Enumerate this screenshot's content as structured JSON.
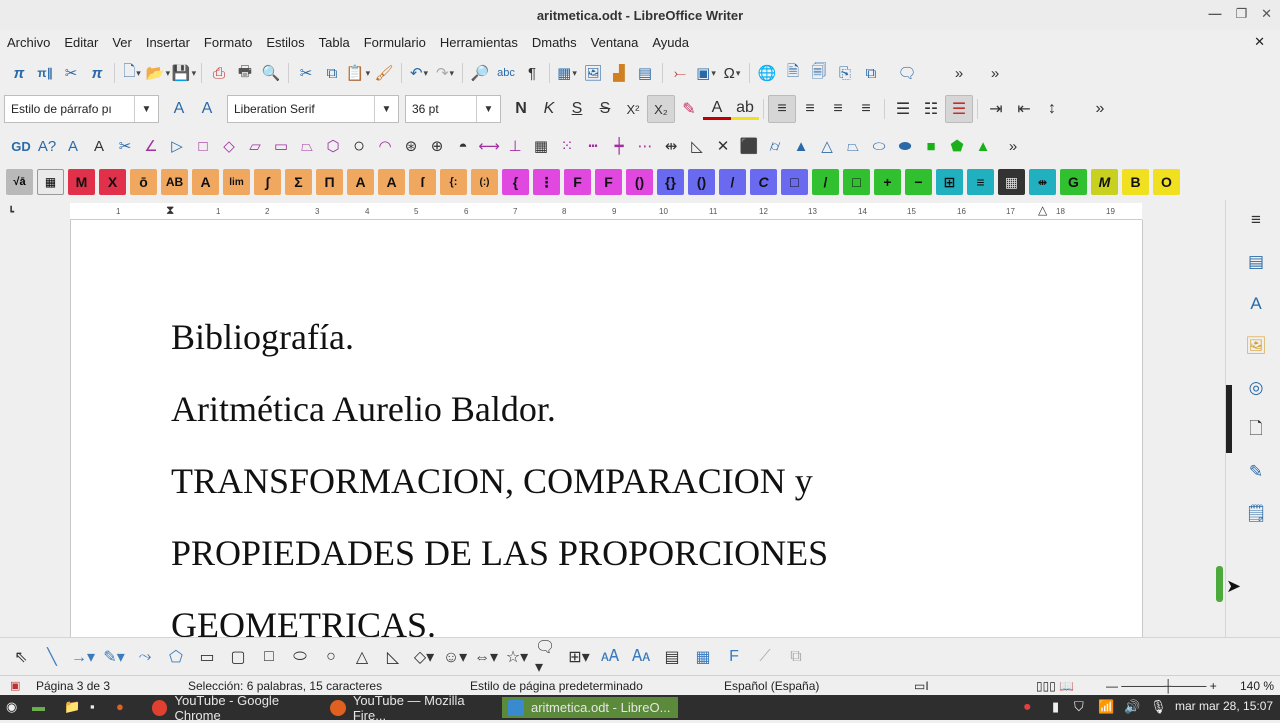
{
  "window": {
    "title": "aritmetica.odt - LibreOffice Writer"
  },
  "menu": [
    "Archivo",
    "Editar",
    "Ver",
    "Insertar",
    "Formato",
    "Estilos",
    "Tabla",
    "Formulario",
    "Herramientas",
    "Dmaths",
    "Ventana",
    "Ayuda"
  ],
  "formatting": {
    "paragraph_style": "Estilo de párrafo pı",
    "font_name": "Liberation Serif",
    "font_size": "36 pt",
    "bold": "N",
    "italic": "K",
    "underline": "S",
    "strike": "S",
    "superscript": "X²",
    "subscript": "X₂"
  },
  "math_toolbar": [
    "M",
    "X",
    "ō",
    "AB",
    "A",
    "lim",
    "∫",
    "Σ",
    "Π",
    "A",
    "A",
    "ſ",
    "{:",
    "(:)",
    "{",
    "⋮",
    "F",
    "F",
    "()",
    "{}",
    "()",
    "/",
    "C",
    "□",
    "/",
    "□",
    "+",
    "−",
    "⊞",
    "≡",
    "▦",
    "⇹",
    "G",
    "M",
    "B",
    "O"
  ],
  "ruler": {
    "labels": [
      "1",
      "1",
      "2",
      "3",
      "4",
      "5",
      "6",
      "7",
      "8",
      "9",
      "10",
      "11",
      "12",
      "13",
      "14",
      "15",
      "16",
      "17",
      "18",
      "19"
    ]
  },
  "document": {
    "lines": [
      "Bibliografía.",
      "Aritmética Aurelio Baldor.",
      "TRANSFORMACION, COMPARACION y",
      "PROPIEDADES DE LAS PROPORCIONES",
      "GEOMETRICAS."
    ]
  },
  "status": {
    "page": "Página 3 de 3",
    "selection": "Selección: 6 palabras, 15 caracteres",
    "page_style": "Estilo de página predeterminado",
    "language": "Español (España)",
    "zoom": "140 %"
  },
  "taskbar": {
    "tasks": [
      "YouTube - Google Chrome",
      "YouTube — Mozilla Fire...",
      "aritmetica.odt - LibreO..."
    ],
    "clock": "mar mar 28, 15:07"
  }
}
